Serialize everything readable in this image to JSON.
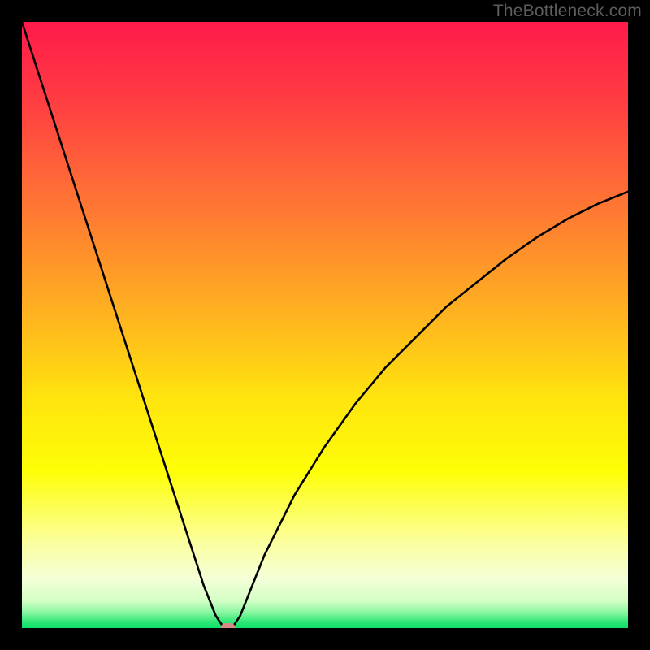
{
  "watermark": "TheBottleneck.com",
  "chart_data": {
    "type": "line",
    "title": "",
    "xlabel": "",
    "ylabel": "",
    "xlim": [
      0,
      100
    ],
    "ylim": [
      0,
      100
    ],
    "x": [
      0,
      5,
      10,
      15,
      20,
      25,
      30,
      32,
      33,
      34,
      35,
      36,
      38,
      40,
      45,
      50,
      55,
      60,
      65,
      70,
      75,
      80,
      85,
      90,
      95,
      100
    ],
    "values": [
      100,
      84.5,
      69,
      53.5,
      38,
      22.5,
      7,
      2,
      0.5,
      0,
      0.5,
      2,
      7,
      12,
      22,
      30,
      37,
      43,
      48,
      53,
      57,
      61,
      64.5,
      67.5,
      70,
      72
    ],
    "minimum_marker": {
      "x": 34,
      "y": 0
    },
    "gradient_stops": [
      {
        "offset": 0.0,
        "color": "#ff1a4a"
      },
      {
        "offset": 0.12,
        "color": "#ff3a43"
      },
      {
        "offset": 0.3,
        "color": "#ff7534"
      },
      {
        "offset": 0.48,
        "color": "#ffb220"
      },
      {
        "offset": 0.62,
        "color": "#ffe40e"
      },
      {
        "offset": 0.74,
        "color": "#fefe06"
      },
      {
        "offset": 0.86,
        "color": "#fbffa0"
      },
      {
        "offset": 0.92,
        "color": "#f3ffd8"
      },
      {
        "offset": 0.955,
        "color": "#d4ffc4"
      },
      {
        "offset": 0.975,
        "color": "#86f6a0"
      },
      {
        "offset": 0.99,
        "color": "#2de675"
      },
      {
        "offset": 1.0,
        "color": "#0ee168"
      }
    ],
    "marker_color": "#d88a84",
    "line_color": "#000000"
  }
}
